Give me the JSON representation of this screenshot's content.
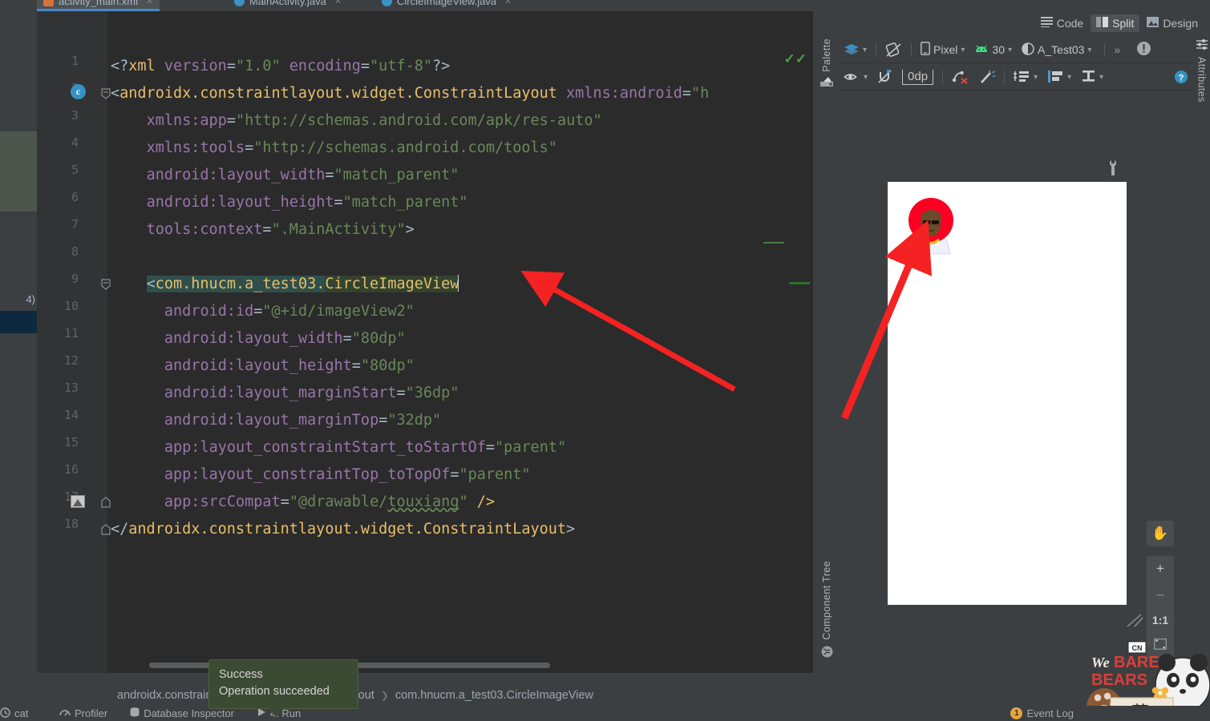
{
  "window": {
    "ide": "Android Studio"
  },
  "tabs": [
    {
      "label": "activity_main.xml",
      "icon": "xml-file-icon",
      "active": true
    },
    {
      "label": "MainActivity.java",
      "icon": "java-file-icon",
      "active": false
    },
    {
      "label": "CircleImageView.java",
      "icon": "java-file-icon",
      "active": false
    }
  ],
  "view_modes": [
    {
      "label": "Code",
      "icon": "code-lines-icon",
      "selected": false
    },
    {
      "label": "Split",
      "icon": "split-panes-icon",
      "selected": true
    },
    {
      "label": "Design",
      "icon": "design-image-icon",
      "selected": false
    }
  ],
  "editor": {
    "language": "xml",
    "line_numbers": [
      1,
      2,
      3,
      4,
      5,
      6,
      7,
      8,
      9,
      10,
      11,
      12,
      13,
      14,
      15,
      16,
      17,
      18
    ],
    "current_line": 9,
    "inspection_status": "ok",
    "lines": [
      {
        "n": 1,
        "indent": 0,
        "tokens": [
          {
            "t": "punc",
            "v": "<?"
          },
          {
            "t": "tag",
            "v": "xml"
          },
          {
            "t": "plain",
            "v": " "
          },
          {
            "t": "attr",
            "v": "version"
          },
          {
            "t": "punc",
            "v": "="
          },
          {
            "t": "val",
            "v": "\"1.0\""
          },
          {
            "t": "plain",
            "v": " "
          },
          {
            "t": "attr",
            "v": "encoding"
          },
          {
            "t": "punc",
            "v": "="
          },
          {
            "t": "val",
            "v": "\"utf-8\""
          },
          {
            "t": "punc",
            "v": "?>"
          }
        ]
      },
      {
        "n": 2,
        "indent": 0,
        "tokens": [
          {
            "t": "punc",
            "v": "<"
          },
          {
            "t": "tag",
            "v": "androidx.constraintlayout.widget.ConstraintLayout"
          },
          {
            "t": "plain",
            "v": " "
          },
          {
            "t": "attr",
            "v": "xmlns:android"
          },
          {
            "t": "punc",
            "v": "="
          },
          {
            "t": "val",
            "v": "\"h"
          }
        ]
      },
      {
        "n": 3,
        "indent": 4,
        "tokens": [
          {
            "t": "attr",
            "v": "xmlns:app"
          },
          {
            "t": "punc",
            "v": "="
          },
          {
            "t": "val",
            "v": "\"http://schemas.android.com/apk/res-auto\""
          }
        ]
      },
      {
        "n": 4,
        "indent": 4,
        "tokens": [
          {
            "t": "attr",
            "v": "xmlns:tools"
          },
          {
            "t": "punc",
            "v": "="
          },
          {
            "t": "val",
            "v": "\"http://schemas.android.com/tools\""
          }
        ]
      },
      {
        "n": 5,
        "indent": 4,
        "tokens": [
          {
            "t": "attr",
            "v": "android:layout_width"
          },
          {
            "t": "punc",
            "v": "="
          },
          {
            "t": "val",
            "v": "\"match_parent\""
          }
        ]
      },
      {
        "n": 6,
        "indent": 4,
        "tokens": [
          {
            "t": "attr",
            "v": "android:layout_height"
          },
          {
            "t": "punc",
            "v": "="
          },
          {
            "t": "val",
            "v": "\"match_parent\""
          }
        ]
      },
      {
        "n": 7,
        "indent": 4,
        "tokens": [
          {
            "t": "attr",
            "v": "tools:context"
          },
          {
            "t": "punc",
            "v": "="
          },
          {
            "t": "val",
            "v": "\".MainActivity\""
          },
          {
            "t": "punc",
            "v": ">"
          }
        ]
      },
      {
        "n": 8,
        "indent": 0,
        "tokens": []
      },
      {
        "n": 9,
        "indent": 4,
        "tokens": [
          {
            "t": "punc sel-a",
            "v": "<"
          },
          {
            "t": "tag sel-a",
            "v": "com.hnucm.a_test03."
          },
          {
            "t": "tag sel-b",
            "v": "CircleImageView"
          }
        ],
        "caret": true
      },
      {
        "n": 10,
        "indent": 6,
        "tokens": [
          {
            "t": "attr",
            "v": "android:id"
          },
          {
            "t": "punc",
            "v": "="
          },
          {
            "t": "val",
            "v": "\"@+id/imageView2\""
          }
        ]
      },
      {
        "n": 11,
        "indent": 6,
        "tokens": [
          {
            "t": "attr",
            "v": "android:layout_width"
          },
          {
            "t": "punc",
            "v": "="
          },
          {
            "t": "val",
            "v": "\"80dp\""
          }
        ]
      },
      {
        "n": 12,
        "indent": 6,
        "tokens": [
          {
            "t": "attr",
            "v": "android:layout_height"
          },
          {
            "t": "punc",
            "v": "="
          },
          {
            "t": "val",
            "v": "\"80dp\""
          }
        ]
      },
      {
        "n": 13,
        "indent": 6,
        "tokens": [
          {
            "t": "attr",
            "v": "android:layout_marginStart"
          },
          {
            "t": "punc",
            "v": "="
          },
          {
            "t": "val",
            "v": "\"36dp\""
          }
        ]
      },
      {
        "n": 14,
        "indent": 6,
        "tokens": [
          {
            "t": "attr",
            "v": "android:layout_marginTop"
          },
          {
            "t": "punc",
            "v": "="
          },
          {
            "t": "val",
            "v": "\"32dp\""
          }
        ]
      },
      {
        "n": 15,
        "indent": 6,
        "tokens": [
          {
            "t": "attr",
            "v": "app:layout_constraintStart_toStartOf"
          },
          {
            "t": "punc",
            "v": "="
          },
          {
            "t": "val",
            "v": "\"parent\""
          }
        ]
      },
      {
        "n": 16,
        "indent": 6,
        "tokens": [
          {
            "t": "attr",
            "v": "app:layout_constraintTop_toTopOf"
          },
          {
            "t": "punc",
            "v": "="
          },
          {
            "t": "val",
            "v": "\"parent\""
          }
        ]
      },
      {
        "n": 17,
        "indent": 6,
        "tokens": [
          {
            "t": "attr",
            "v": "app:srcCompat"
          },
          {
            "t": "punc",
            "v": "="
          },
          {
            "t": "val",
            "v": "\"@drawable/"
          },
          {
            "t": "val squig",
            "v": "touxiang"
          },
          {
            "t": "val",
            "v": "\""
          },
          {
            "t": "plain",
            "v": " "
          },
          {
            "t": "tag",
            "v": "/>"
          }
        ]
      },
      {
        "n": 18,
        "indent": 0,
        "tokens": [
          {
            "t": "punc",
            "v": "</"
          },
          {
            "t": "tag",
            "v": "androidx.constraintlayout.widget.ConstraintLayout"
          },
          {
            "t": "punc",
            "v": ">"
          }
        ]
      }
    ]
  },
  "panels": {
    "palette": "Palette",
    "component_tree": "Component Tree",
    "attributes": "Attributes"
  },
  "design_toolbar": {
    "row1": [
      {
        "name": "design-surface-mode-icon",
        "label": "",
        "icon": "layers-icon",
        "caret": true
      },
      {
        "name": "orientation-icon",
        "label": "",
        "icon": "rotate-screen-icon",
        "caret": false
      },
      {
        "name": "device-selector",
        "label": "Pixel",
        "icon": "phone-icon",
        "caret": true
      },
      {
        "name": "api-level-selector",
        "label": "30",
        "icon": "android-robot-icon",
        "caret": true
      },
      {
        "name": "theme-selector",
        "label": "A_Test03",
        "icon": "theme-contrast-icon",
        "caret": true
      },
      {
        "name": "overflow-button",
        "label": "»",
        "icon": "chevron-double-right-icon",
        "caret": false
      },
      {
        "name": "issue-notification",
        "label": "",
        "icon": "warning-circle-icon",
        "caret": false
      }
    ],
    "row2": [
      {
        "name": "view-options-icon",
        "icon": "eye-icon",
        "label": "",
        "caret": true
      },
      {
        "name": "autoconnect-icon",
        "icon": "magnet-off-icon",
        "label": "",
        "caret": false
      },
      {
        "name": "default-margin",
        "icon": "margin-icon",
        "label": "0dp",
        "caret": false
      },
      {
        "name": "clear-constraints-icon",
        "icon": "clear-constraints-icon",
        "label": "",
        "caret": false
      },
      {
        "name": "infer-constraints-icon",
        "icon": "magic-wand-icon",
        "label": "",
        "caret": false
      },
      {
        "name": "guidelines-icon",
        "icon": "guidelines-icon",
        "label": "",
        "caret": true
      },
      {
        "name": "align-icon",
        "icon": "align-left-icon",
        "label": "",
        "caret": true
      },
      {
        "name": "baseline-icon",
        "icon": "baseline-icon",
        "label": "",
        "caret": true
      },
      {
        "name": "help-icon",
        "icon": "question-circle-icon",
        "label": "",
        "caret": false
      }
    ]
  },
  "zoom_controls": [
    {
      "name": "pan-tool",
      "label": "✋",
      "icon": "hand-icon"
    },
    {
      "name": "zoom-in",
      "label": "+",
      "icon": "plus-icon"
    },
    {
      "name": "zoom-out",
      "label": "–",
      "icon": "minus-icon"
    },
    {
      "name": "zoom-actual",
      "label": "1:1",
      "icon": "one-to-one-icon"
    },
    {
      "name": "zoom-to-fit",
      "label": "",
      "icon": "fit-screen-icon"
    }
  ],
  "preview": {
    "device": "Pixel",
    "avatar_alt": "touxiang drawable preview",
    "background": "#ffffff"
  },
  "tooltip": {
    "title": "Success",
    "message": "Operation succeeded"
  },
  "breadcrumb": [
    "androidx.constraintlayout.widget.ConstraintLayout",
    "com.hnucm.a_test03.CircleImageView"
  ],
  "statusbar": {
    "left": [
      {
        "label": "cat",
        "icon": "logcat-icon"
      },
      {
        "label": "Profiler",
        "icon": "profiler-icon"
      },
      {
        "label": "Database Inspector",
        "icon": "database-icon"
      },
      {
        "label": "4: Run",
        "icon": "run-play-icon"
      }
    ],
    "right": [
      {
        "label": "Event Log",
        "icon": "event-log-icon",
        "badge": "1"
      }
    ]
  },
  "colors": {
    "editor_bg": "#2b2b2b",
    "gutter_bg": "#313335",
    "chrome_bg": "#3c3f41",
    "tab_active": "#4e5254",
    "tab_underline": "#4a88c7",
    "tag": "#e8bf6a",
    "attr": "#9876aa",
    "value": "#6a8759",
    "punct": "#a9b7c6",
    "selection_a": "#2f4f4d",
    "selection_b": "#32432f",
    "arrow": "#f42222",
    "tooltip_bg": "#3b4a32",
    "badge": "#e8a33d"
  }
}
